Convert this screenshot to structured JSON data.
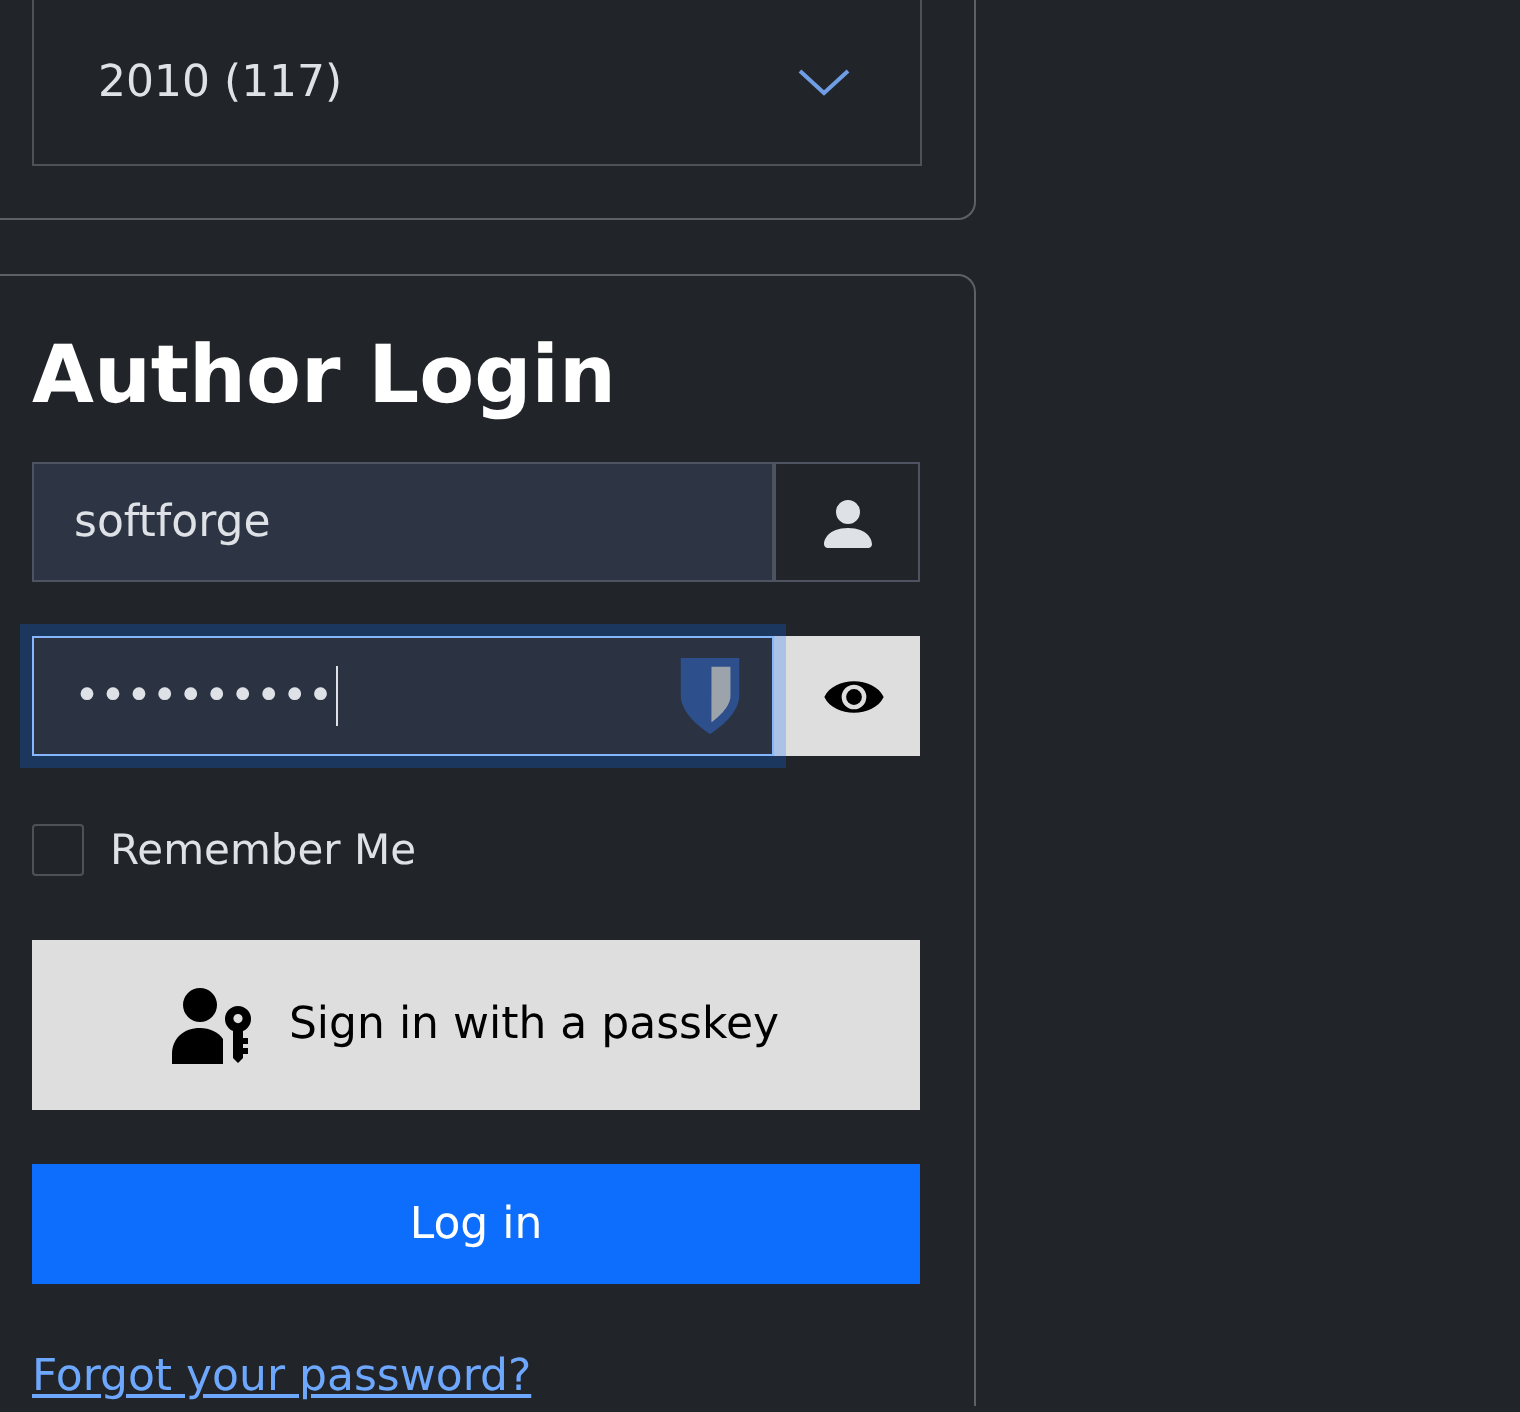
{
  "year_filter": {
    "value": "2010 (117)"
  },
  "login": {
    "title": "Author Login",
    "username": {
      "value": "softforge"
    },
    "password": {
      "value": "••••••••••",
      "focused": true
    },
    "remember_me": {
      "label": "Remember Me",
      "checked": false
    },
    "passkey_button": {
      "label": "Sign in with a passkey"
    },
    "login_button": {
      "label": "Log in"
    },
    "forgot_password_link": {
      "label": "Forgot your password?"
    }
  }
}
